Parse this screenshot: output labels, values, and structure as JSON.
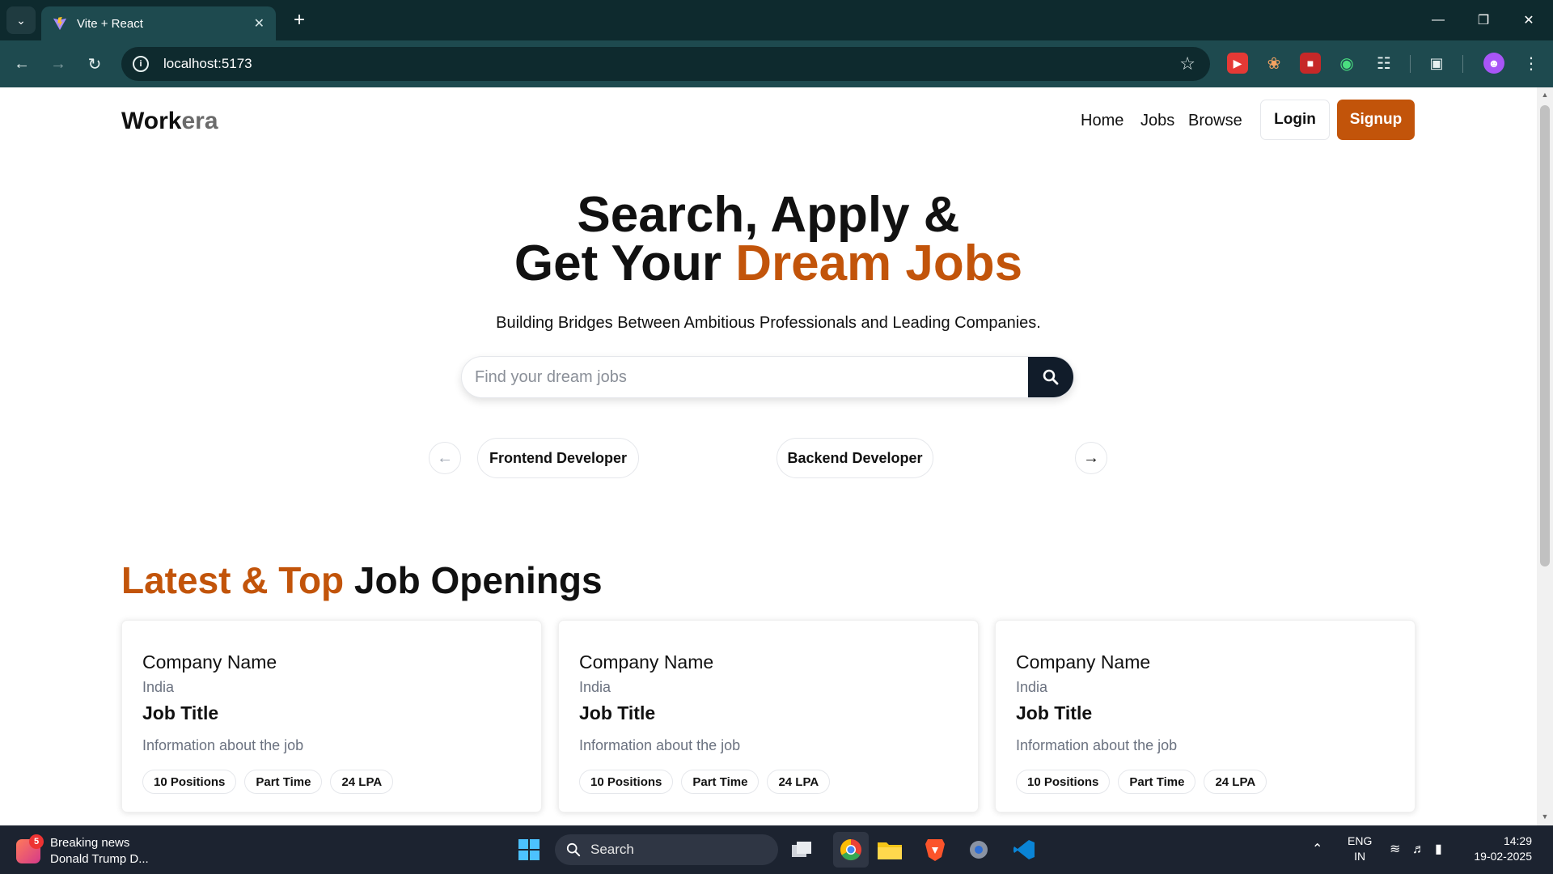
{
  "browser": {
    "tab_title": "Vite + React",
    "url": "localhost:5173"
  },
  "site": {
    "logo_work": "Work",
    "logo_era": "era",
    "nav": [
      "Home",
      "Jobs",
      "Browse"
    ],
    "login_label": "Login",
    "signup_label": "Signup",
    "accent_color": "#c2540a"
  },
  "hero": {
    "line1": "Search, Apply &",
    "line2_plain": "Get Your ",
    "line2_accent": "Dream Jobs",
    "subtitle": "Building Bridges Between Ambitious Professionals and Leading Companies.",
    "search_placeholder": "Find your dream jobs"
  },
  "categories": {
    "items": [
      "Frontend Developer",
      "Backend Developer"
    ]
  },
  "jobs": {
    "heading_accent": "Latest & Top",
    "heading_plain": " Job Openings",
    "cards": [
      {
        "company": "Company Name",
        "location": "India",
        "title": "Job Title",
        "info": "Information about the job",
        "positions": "10 Positions",
        "type": "Part Time",
        "salary": "24 LPA"
      },
      {
        "company": "Company Name",
        "location": "India",
        "title": "Job Title",
        "info": "Information about the job",
        "positions": "10 Positions",
        "type": "Part Time",
        "salary": "24 LPA"
      },
      {
        "company": "Company Name",
        "location": "India",
        "title": "Job Title",
        "info": "Information about the job",
        "positions": "10 Positions",
        "type": "Part Time",
        "salary": "24 LPA"
      }
    ]
  },
  "taskbar": {
    "news_count": "5",
    "news_title": "Breaking news",
    "news_sub": "Donald Trump D...",
    "search_label": "Search",
    "lang": "ENG",
    "region": "IN",
    "time": "14:29",
    "date": "19-02-2025"
  }
}
